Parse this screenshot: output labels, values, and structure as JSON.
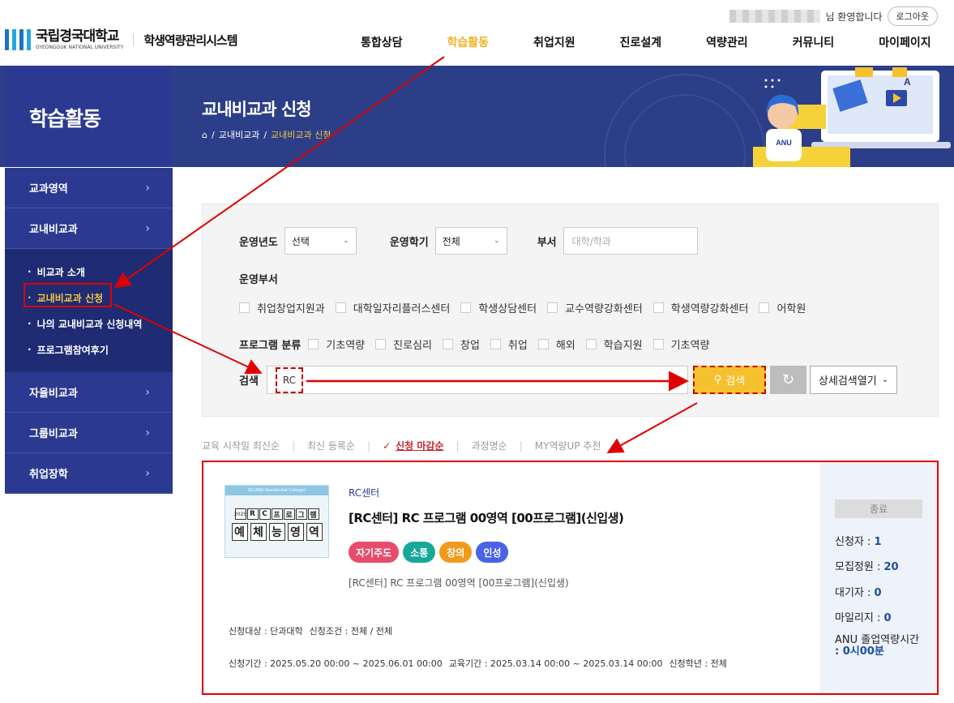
{
  "header": {
    "welcome_suffix": "님 환영합니다",
    "logout": "로그아웃",
    "logo_ko": "국립경국대학교",
    "logo_en": "GYEONGGUK NATIONAL UNIVERSITY",
    "system_name": "학생역량관리시스템",
    "nav": [
      "통합상담",
      "학습활동",
      "취업지원",
      "진로설계",
      "역량관리",
      "커뮤니티",
      "마이페이지"
    ],
    "nav_active_index": 1,
    "nav_active_color": "#f2b320"
  },
  "banner": {
    "section_title": "학습활동",
    "page_title": "교내비교과 신청",
    "breadcrumb": [
      "교내비교과",
      "교내비교과 신청"
    ],
    "badge_text": "ANU",
    "bg_color": "#2c3e88"
  },
  "sidebar": {
    "items": [
      {
        "label": "교과영역"
      },
      {
        "label": "교내비교과"
      },
      {
        "label": "자율비교과"
      },
      {
        "label": "그룹비교과"
      },
      {
        "label": "취업장학"
      }
    ],
    "sub_items": [
      {
        "label": "비교과 소개"
      },
      {
        "label": "교내비교과 신청"
      },
      {
        "label": "나의 교내비교과 신청내역"
      },
      {
        "label": "프로그램참여후기"
      }
    ],
    "active_sub_index": 1
  },
  "search": {
    "year_label": "운영년도",
    "year_value": "선택",
    "semester_label": "운영학기",
    "semester_value": "전체",
    "dept_label": "부서",
    "dept_placeholder": "대학/학과",
    "org_label": "운영부서",
    "orgs": [
      "취업창업지원과",
      "대학일자리플러스센터",
      "학생상담센터",
      "교수역량강화센터",
      "학생역량강화센터",
      "어학원"
    ],
    "category_label": "프로그램 분류",
    "categories": [
      "기초역량",
      "진로심리",
      "창업",
      "취업",
      "해외",
      "학습지원",
      "기초역량"
    ],
    "keyword_label": "검색",
    "keyword_value": "RC",
    "search_button": "검색",
    "advanced_button": "상세검색열기"
  },
  "sort": {
    "options": [
      "교육 시작일 최신순",
      "최신 등록순",
      "신청 마감순",
      "과정명순",
      "MY역량UP 추천"
    ],
    "active_index": 2
  },
  "result": {
    "org": "RC센터",
    "title": "[RC센터] RC 프로그램 00영역 [00프로그램](신입생)",
    "tags": [
      {
        "label": "자기주도",
        "color": "#e84b6c"
      },
      {
        "label": "소통",
        "color": "#16a99a"
      },
      {
        "label": "창의",
        "color": "#f29a1b"
      },
      {
        "label": "인성",
        "color": "#4a63e6"
      }
    ],
    "description": "[RC센터] RC 프로그램 00영역 [00프로그램](신입생)",
    "target_label": "신청대상 : 단과대학",
    "condition_label": "신청조건 : 전체 / 전체",
    "apply_period": "신청기간 : 2025.05.20 00:00 ~ 2025.06.01 00:00",
    "edu_period": "교육기간 : 2025.03.14 00:00 ~ 2025.03.14 00:00",
    "grade": "신청학년 : 전체",
    "status": "종료",
    "applicants_label": "신청자 : ",
    "applicants": "1",
    "capacity_label": "모집정원 : ",
    "capacity": "20",
    "waiting_label": "대기자 : ",
    "waiting": "0",
    "mileage_label": "마일리지 : ",
    "mileage": "0",
    "anu_label": "ANU 졸업역량시간",
    "anu_value": ": 0시00분",
    "thumb": {
      "caption": "RC(ANU Residential College)",
      "line1": [
        "2025",
        "R",
        "C",
        "프",
        "로",
        "그",
        "램"
      ],
      "line2": [
        "예",
        "체",
        "능",
        "영",
        "역"
      ]
    }
  },
  "annotation_color": "#e00000"
}
